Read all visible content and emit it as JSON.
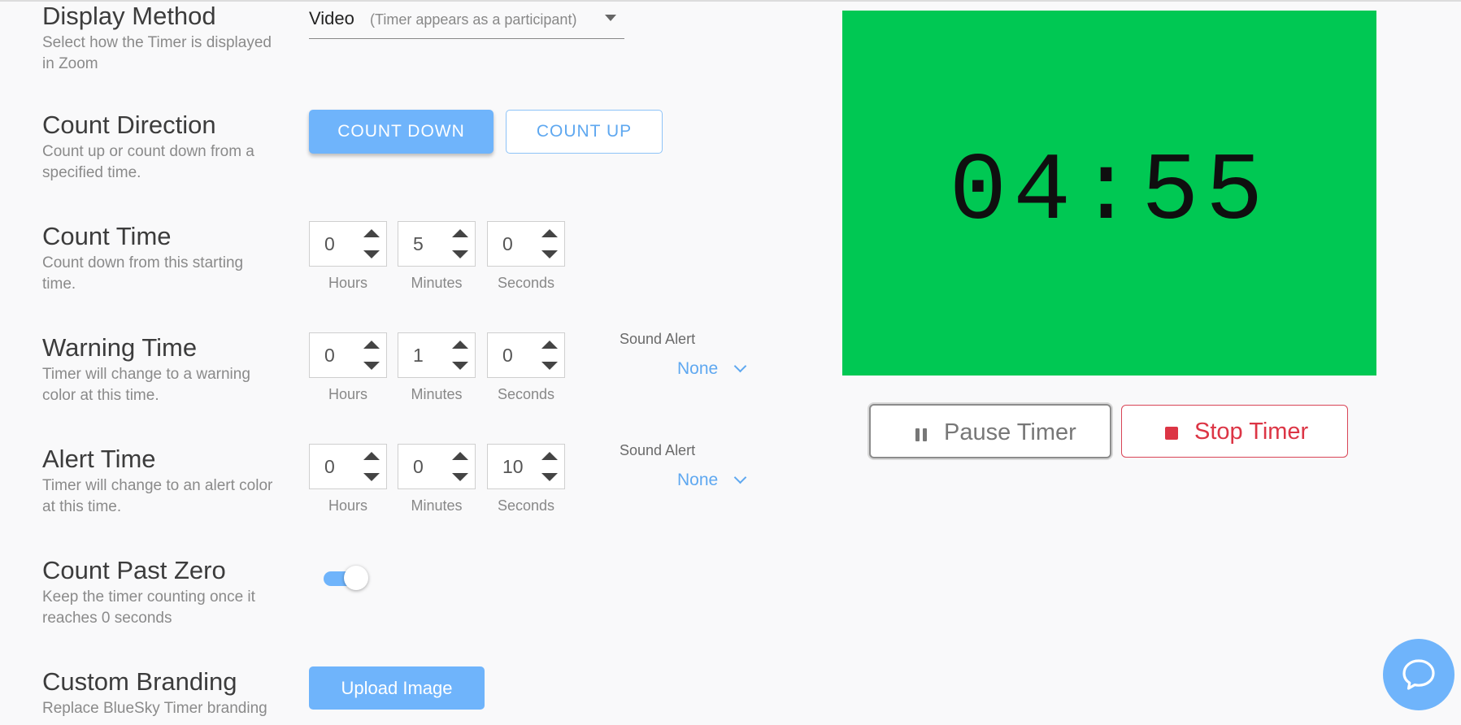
{
  "display_method": {
    "title": "Display Method",
    "desc": "Select how the Timer is displayed in Zoom",
    "value": "Video",
    "hint": "(Timer appears as a participant)"
  },
  "count_direction": {
    "title": "Count Direction",
    "desc": "Count up or count down from a specified time.",
    "down_label": "COUNT DOWN",
    "up_label": "COUNT UP"
  },
  "count_time": {
    "title": "Count Time",
    "desc": "Count down from this starting time.",
    "hours": "0",
    "minutes": "5",
    "seconds": "0"
  },
  "warning_time": {
    "title": "Warning Time",
    "desc": "Timer will change to a warning color at this time.",
    "hours": "0",
    "minutes": "1",
    "seconds": "0",
    "sound_label": "Sound Alert",
    "sound_value": "None"
  },
  "alert_time": {
    "title": "Alert Time",
    "desc": "Timer will change to an alert color at this time.",
    "hours": "0",
    "minutes": "0",
    "seconds": "10",
    "sound_label": "Sound Alert",
    "sound_value": "None"
  },
  "units": {
    "hours": "Hours",
    "minutes": "Minutes",
    "seconds": "Seconds"
  },
  "count_past_zero": {
    "title": "Count Past Zero",
    "desc": "Keep the timer counting once it reaches 0 seconds",
    "enabled": true
  },
  "custom_branding": {
    "title": "Custom Branding",
    "desc": "Replace BlueSky Timer branding",
    "upload_label": "Upload Image"
  },
  "timer": {
    "display": "04:55",
    "background_color": "#00c853",
    "pause_label": "Pause Timer",
    "stop_label": "Stop Timer"
  },
  "colors": {
    "accent": "#6fb4fb",
    "danger": "#dc3545"
  }
}
